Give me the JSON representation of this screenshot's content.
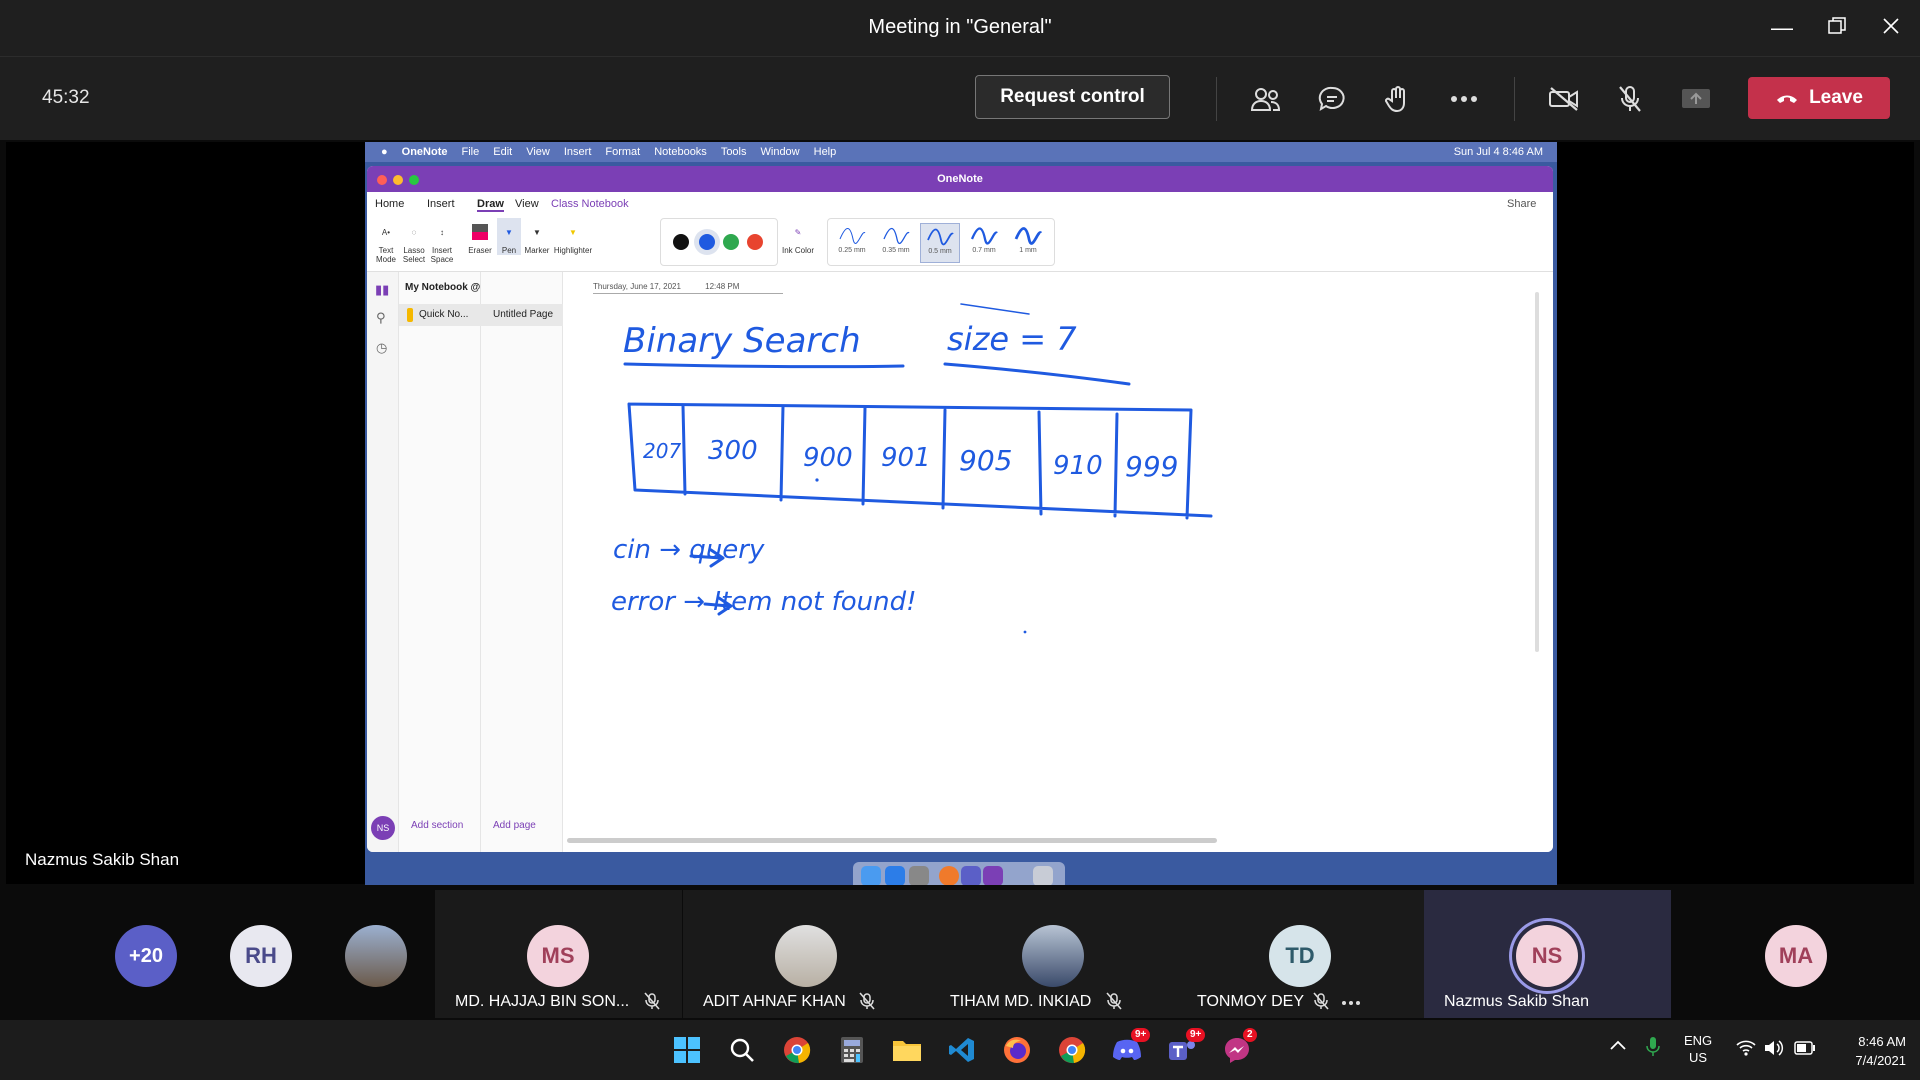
{
  "window": {
    "title": "Meeting in \"General\""
  },
  "toolbar": {
    "timer": "45:32",
    "request_control_label": "Request control",
    "leave_label": "Leave"
  },
  "stage": {
    "presenter_name": "Nazmus Sakib Shan"
  },
  "mac": {
    "menu": [
      "OneNote",
      "File",
      "Edit",
      "View",
      "Insert",
      "Format",
      "Notebooks",
      "Tools",
      "Window",
      "Help"
    ],
    "clock": "Sun Jul 4  8:46 AM"
  },
  "onenote": {
    "title": "OneNote",
    "tabs": [
      "Home",
      "Insert",
      "Draw",
      "View",
      "Class Notebook"
    ],
    "active_tab": "Draw",
    "share_label": "Share",
    "tools": [
      {
        "label": "Text Mode",
        "icon": "text-mode-icon"
      },
      {
        "label": "Lasso Select",
        "icon": "lasso-icon"
      },
      {
        "label": "Insert Space",
        "icon": "insert-space-icon"
      },
      {
        "label": "Eraser",
        "icon": "eraser-icon"
      },
      {
        "label": "Pen",
        "icon": "pen-icon"
      },
      {
        "label": "Marker",
        "icon": "marker-icon"
      },
      {
        "label": "Highlighter",
        "icon": "highlighter-icon"
      }
    ],
    "colors": [
      "#111111",
      "#1f5ae0",
      "#2fa84f",
      "#e8442f"
    ],
    "ink_color_label": "Ink Color",
    "pen_widths": [
      "0.25 mm",
      "0.35 mm",
      "0.5 mm",
      "0.7 mm",
      "1 mm"
    ],
    "selected_width": "0.5 mm",
    "notebook_name": "My Notebook @ A...",
    "section": "Quick No...",
    "page": "Untitled Page",
    "add_section": "Add section",
    "add_page": "Add page",
    "user_initials": "NS",
    "page_date": "Thursday, June 17, 2021",
    "page_time": "12:48 PM",
    "ink": {
      "heading": "Binary Search",
      "size_note": "size = 7",
      "array": [
        "207",
        "300",
        "900",
        "901",
        "905",
        "910",
        "999"
      ],
      "line1": "cin → query",
      "line2": "error → Item not found!"
    }
  },
  "participants": {
    "overflow": "+20",
    "small": [
      {
        "initials": "RH",
        "bg": "#e8e8f0",
        "fg": "#4a4a8a"
      },
      {
        "initials": "",
        "bg": "#6b5a4a",
        "fg": "#ffffff"
      }
    ],
    "tiles": [
      {
        "initials": "MS",
        "name": "MD. HAJJAJ BIN SON...",
        "bg": "#f3d3dd",
        "fg": "#a0405a",
        "muted": true
      },
      {
        "initials": "",
        "name": "ADIT AHNAF KHAN",
        "bg": "#d8d2c8",
        "fg": "#333333",
        "muted": true
      },
      {
        "initials": "",
        "name": "TIHAM MD. INKIAD",
        "bg": "#8a9ab0",
        "fg": "#ffffff",
        "muted": true
      },
      {
        "initials": "TD",
        "name": "TONMOY DEY",
        "bg": "#d6e4ea",
        "fg": "#2e5a6a",
        "muted": true
      },
      {
        "initials": "NS",
        "name": "Nazmus Sakib Shan",
        "bg": "#f3d3dd",
        "fg": "#a0405a",
        "muted": false
      },
      {
        "initials": "MA",
        "name": "",
        "bg": "#f3d3dd",
        "fg": "#a0405a",
        "muted": false
      }
    ]
  },
  "taskbar": {
    "apps": [
      "start-icon",
      "search-icon",
      "chrome-icon",
      "calculator-icon",
      "file-explorer-icon",
      "vscode-icon",
      "firefox-icon",
      "chrome-icon",
      "discord-icon",
      "teams-icon",
      "messenger-icon"
    ],
    "discord_badge": "9+",
    "teams_badge": "9+",
    "messenger_badge": "2",
    "lang_top": "ENG",
    "lang_bottom": "US",
    "time": "8:46 AM",
    "date": "7/4/2021"
  }
}
